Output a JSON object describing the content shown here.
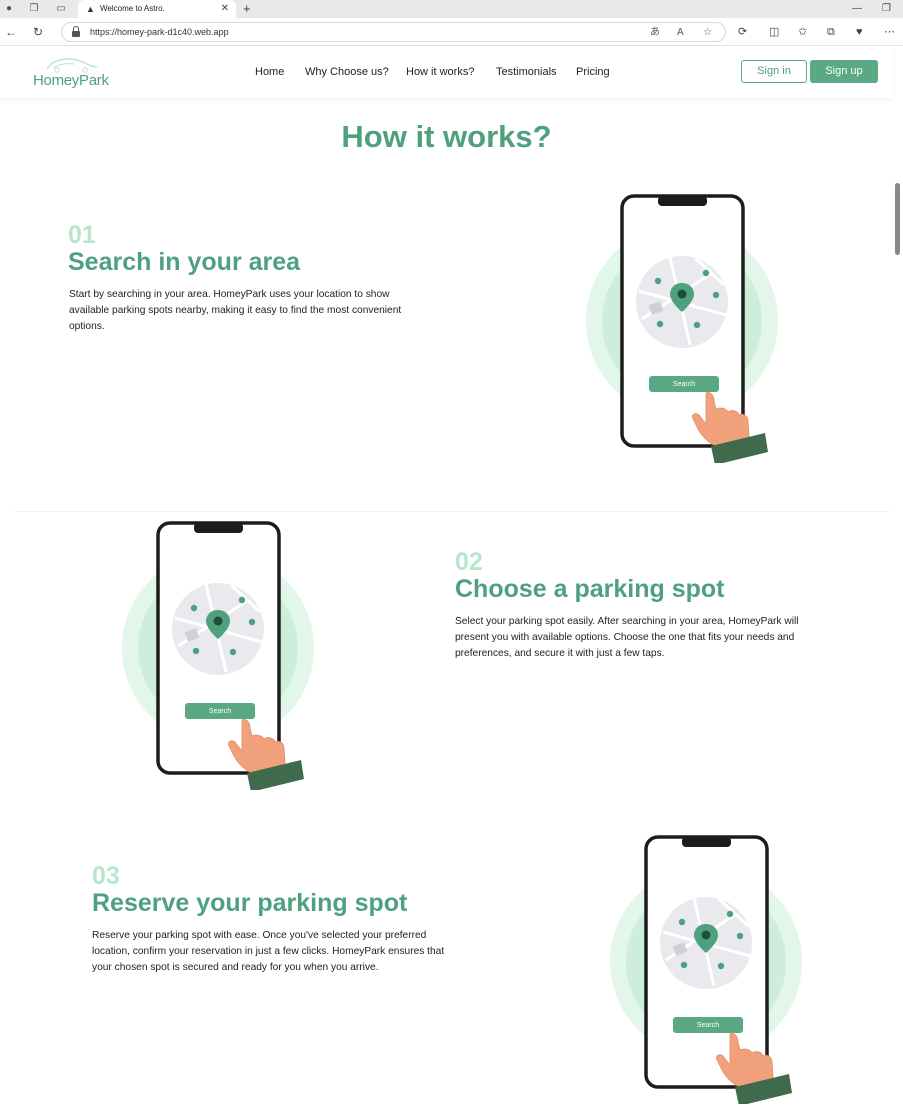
{
  "browser": {
    "tab_title": "Welcome to Astro.",
    "url": "https://homey-park-d1c40.web.app"
  },
  "header": {
    "logo_text": "HomeyPark",
    "nav": [
      "Home",
      "Why Choose us?",
      "How it works?",
      "Testimonials",
      "Pricing"
    ],
    "signin_label": "Sign in",
    "signup_label": "Sign up"
  },
  "section": {
    "title": "How it works?"
  },
  "steps": [
    {
      "number": "01",
      "title": "Search in your area",
      "lines": [
        "Start by searching in your area. HomeyPark uses your location to show",
        "available parking spots nearby, making it easy to find the most convenient",
        "options."
      ],
      "search_label": "Search"
    },
    {
      "number": "02",
      "title": "Choose a parking spot",
      "lines": [
        "Select your parking spot easily. After searching in your area, HomeyPark will",
        "present you with available options. Choose the one that fits your needs and",
        "preferences, and secure it with just a few taps."
      ],
      "search_label": "Search"
    },
    {
      "number": "03",
      "title": "Reserve your parking spot",
      "lines": [
        "Reserve your parking spot with ease. Once you've selected your preferred",
        "location, confirm your reservation in just a few clicks. HomeyPark ensures that",
        "your chosen spot is secured and ready for you when you arrive."
      ],
      "search_label": "Search"
    }
  ],
  "colors": {
    "brand": "#4ea07f",
    "brand_light": "#b8e6cc",
    "halo": "#d9f3e4",
    "hand": "#f0a07a",
    "sleeve": "#3f6b4c"
  },
  "icons": {
    "back": "back-arrow-icon",
    "refresh": "refresh-icon",
    "lock": "lock-icon",
    "favorite": "star-icon",
    "more": "more-icon"
  }
}
